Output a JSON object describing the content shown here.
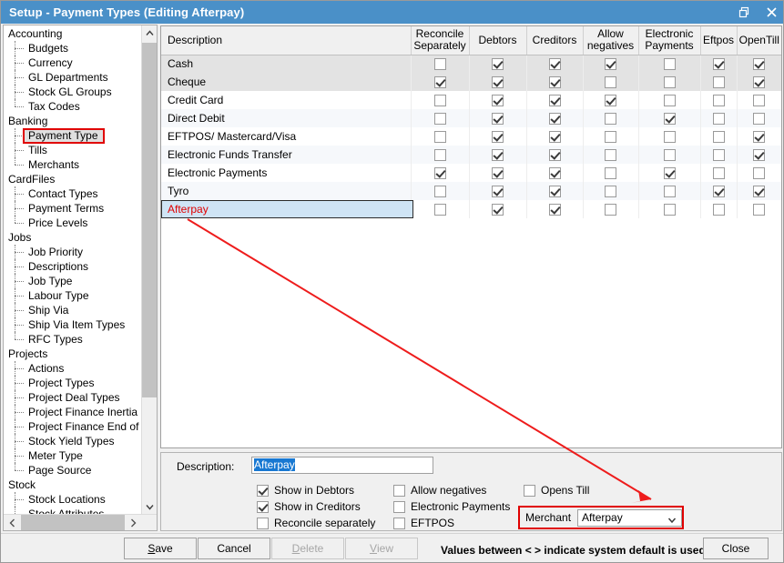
{
  "window": {
    "title": "Setup - Payment Types (Editing Afterpay)",
    "restore_icon": "restore-window-icon",
    "close_icon": "close-window-icon"
  },
  "sidebar": {
    "groups": [
      {
        "label": "Accounting",
        "items": [
          "Budgets",
          "Currency",
          "GL Departments",
          "Stock GL Groups",
          "Tax Codes"
        ]
      },
      {
        "label": "Banking",
        "items": [
          "Payment Type",
          "Tills",
          "Merchants"
        ]
      },
      {
        "label": "CardFiles",
        "items": [
          "Contact Types",
          "Payment Terms",
          "Price Levels"
        ]
      },
      {
        "label": "Jobs",
        "items": [
          "Job Priority",
          "Descriptions",
          "Job Type",
          "Labour Type",
          "Ship Via",
          "Ship Via Item Types",
          "RFC Types"
        ]
      },
      {
        "label": "Projects",
        "items": [
          "Actions",
          "Project Types",
          "Project Deal Types",
          "Project Finance Inertia",
          "Project Finance End of Term",
          "Stock Yield Types",
          "Meter Type",
          "Page Source"
        ]
      },
      {
        "label": "Stock",
        "items": [
          "Stock Locations",
          "Stock Attributes"
        ]
      }
    ],
    "selected": "Payment Type",
    "selection_highlight_color": "#e00000",
    "scroll_up_icon": "chevron-up-icon",
    "scroll_down_icon": "chevron-down-icon",
    "scroll_left_icon": "chevron-left-icon",
    "scroll_right_icon": "chevron-right-icon"
  },
  "grid": {
    "columns": [
      "Description",
      "Reconcile Separately",
      "Debtors",
      "Creditors",
      "Allow negatives",
      "Electronic Payments",
      "Eftpos",
      "OpenTill"
    ],
    "rows": [
      {
        "description": "Cash",
        "reconcile": false,
        "debtors": true,
        "creditors": true,
        "allow_negatives": true,
        "electronic_payments": false,
        "eftpos": true,
        "opentill": true
      },
      {
        "description": "Cheque",
        "reconcile": true,
        "debtors": true,
        "creditors": true,
        "allow_negatives": false,
        "electronic_payments": false,
        "eftpos": false,
        "opentill": true
      },
      {
        "description": "Credit Card",
        "reconcile": false,
        "debtors": true,
        "creditors": true,
        "allow_negatives": true,
        "electronic_payments": false,
        "eftpos": false,
        "opentill": false
      },
      {
        "description": "Direct Debit",
        "reconcile": false,
        "debtors": true,
        "creditors": true,
        "allow_negatives": false,
        "electronic_payments": true,
        "eftpos": false,
        "opentill": false
      },
      {
        "description": "EFTPOS/ Mastercard/Visa",
        "reconcile": false,
        "debtors": true,
        "creditors": true,
        "allow_negatives": false,
        "electronic_payments": false,
        "eftpos": false,
        "opentill": true
      },
      {
        "description": "Electronic Funds Transfer",
        "reconcile": false,
        "debtors": true,
        "creditors": true,
        "allow_negatives": false,
        "electronic_payments": false,
        "eftpos": false,
        "opentill": true
      },
      {
        "description": "Electronic Payments",
        "reconcile": true,
        "debtors": true,
        "creditors": true,
        "allow_negatives": false,
        "electronic_payments": true,
        "eftpos": false,
        "opentill": false
      },
      {
        "description": "Tyro",
        "reconcile": false,
        "debtors": true,
        "creditors": true,
        "allow_negatives": false,
        "electronic_payments": false,
        "eftpos": true,
        "opentill": true
      },
      {
        "description": "Afterpay",
        "reconcile": false,
        "debtors": true,
        "creditors": true,
        "allow_negatives": false,
        "electronic_payments": false,
        "eftpos": false,
        "opentill": false,
        "selected": true
      }
    ]
  },
  "detail": {
    "description_label": "Description:",
    "description_value": "Afterpay",
    "checkboxes": [
      {
        "label": "Show in Debtors",
        "checked": true
      },
      {
        "label": "Show in Creditors",
        "checked": true
      },
      {
        "label": "Reconcile separately",
        "checked": false
      },
      {
        "label": "Allow negatives",
        "checked": false
      },
      {
        "label": "Electronic Payments",
        "checked": false
      },
      {
        "label": "EFTPOS",
        "checked": false
      },
      {
        "label": "Opens Till",
        "checked": false
      }
    ],
    "merchant_label": "Merchant",
    "merchant_value": "Afterpay",
    "merchant_chevron_icon": "chevron-down-icon",
    "merchant_highlight_color": "#e00000"
  },
  "footer": {
    "save": "Save",
    "cancel": "Cancel",
    "delete": "Delete",
    "view": "View",
    "close": "Close",
    "status": "Values between < > indicate system default is used"
  }
}
